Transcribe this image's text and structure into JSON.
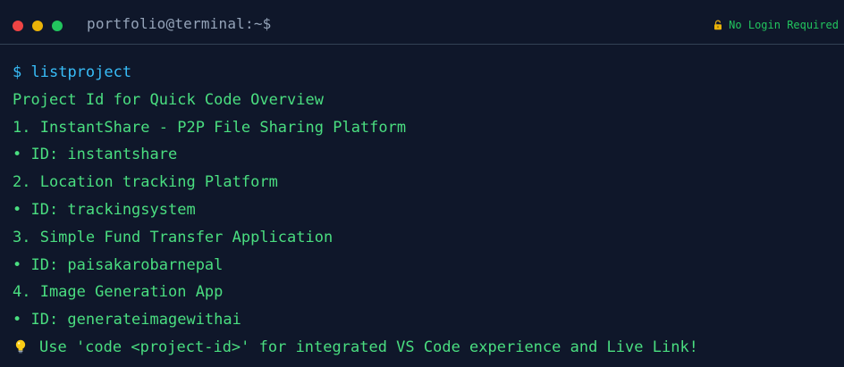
{
  "window": {
    "title": "portfolio@terminal:~$",
    "status_text": "No Login Required",
    "lock_icon": "lock-icon",
    "controls": [
      "close",
      "minimize",
      "maximize"
    ]
  },
  "terminal": {
    "prompt_symbol": "$",
    "command": "listproject",
    "header": "Project Id for Quick Code Overview",
    "projects": [
      {
        "title": "1. InstantShare - P2P File Sharing Platform",
        "id_line": "• ID: instantshare"
      },
      {
        "title": "2. Location tracking Platform",
        "id_line": "• ID: trackingsystem"
      },
      {
        "title": "3. Simple Fund Transfer Application",
        "id_line": "• ID: paisakarobarnepal"
      },
      {
        "title": "4. Image Generation App",
        "id_line": "• ID: generateimagewithai"
      }
    ],
    "hint": "Use 'code <project-id>' for integrated VS Code experience and Live Link!",
    "hint_icon": "lightbulb-icon"
  },
  "colors": {
    "background": "#0f172a",
    "prompt": "#38bdf8",
    "output": "#4ade80",
    "title": "#94a3b8"
  }
}
